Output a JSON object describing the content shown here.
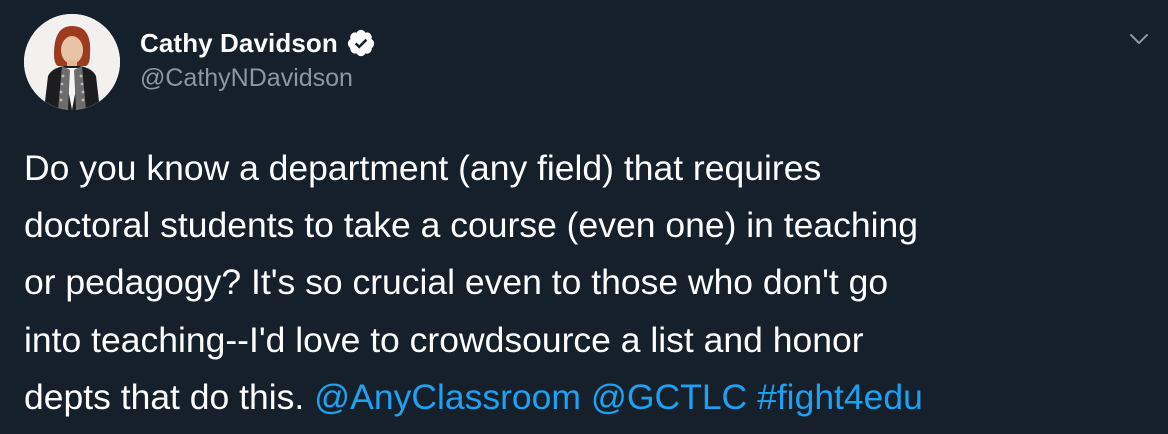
{
  "author": {
    "display_name": "Cathy Davidson",
    "handle": "@CathyNDavidson",
    "verified": true,
    "avatar_icon": "profile-photo"
  },
  "menu_icon": "chevron-down-icon",
  "tweet": {
    "lines": [
      "Do you know a department (any field) that requires",
      "doctoral students to take a course (even one) in teaching",
      "or pedagogy? It's so crucial even to those who don't go",
      "into teaching--I'd love to crowdsource a list and honor"
    ],
    "last_line_text": "depts that do this. ",
    "mentions": [
      "@AnyClassroom",
      "@GCTLC"
    ],
    "hashtag": "#fight4edu"
  },
  "colors": {
    "background": "#15202b",
    "text": "#ffffff",
    "secondary_text": "#8899a6",
    "link": "#1da1f2"
  }
}
